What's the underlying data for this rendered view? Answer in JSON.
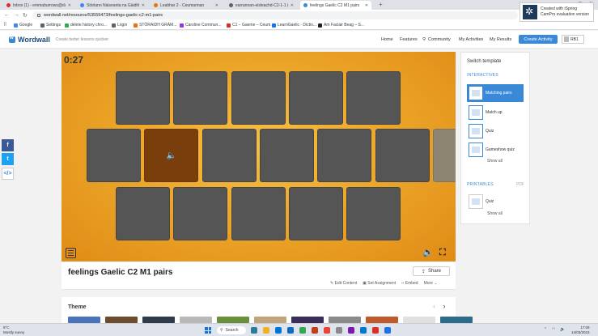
{
  "browser": {
    "tabs": [
      {
        "title": "Inbox (1) - emmaburrows@dunn...",
        "color": "#d93025",
        "active": false
      },
      {
        "title": "Stòrlann Nàiseanta na Gàidhlig...",
        "color": "#4285f4",
        "active": false
      },
      {
        "title": "Leabhar 2 - Ceumannan",
        "color": "#e8710a",
        "active": false
      },
      {
        "title": "earrannan-eisleachd-C2-1-1 (1)...",
        "color": "#5f6368",
        "active": false
      },
      {
        "title": "feelings Gaelic C2 M1 pairs",
        "color": "#3a89d8",
        "active": true
      }
    ],
    "url": "wordwall.net/resource/53559473/feelings-gaelic-c2-m1-pairs",
    "bookmarks": [
      {
        "label": "Google",
        "color": "#4285f4"
      },
      {
        "label": "Settings",
        "color": "#5f6368"
      },
      {
        "label": "delete history chro...",
        "color": "#34a853"
      },
      {
        "label": "Login",
        "color": "#5f6368"
      },
      {
        "label": "STÒRAIDH GRÀM...",
        "color": "#e8710a"
      },
      {
        "label": "Caroline Commun...",
        "color": "#9334e6"
      },
      {
        "label": "C1 – Gaeme – Ceum...",
        "color": "#d93025"
      },
      {
        "label": "LearnGaelic - Dictio...",
        "color": "#1a73e8"
      },
      {
        "label": "Am Faclair Beag – S...",
        "color": "#202124"
      }
    ]
  },
  "ispring": {
    "line1": "Created with iSpring",
    "line2": "CamPro evaluation version"
  },
  "header": {
    "logo_text": "Wordwall",
    "tagline": "Create better lessons quicker",
    "nav": [
      "Home",
      "Features",
      "Community",
      "My Activities",
      "My Results"
    ],
    "create_label": "Create Activity",
    "user_label": "RB1"
  },
  "game": {
    "timer": "0:27",
    "cards": [
      {
        "row": 0,
        "state": "hidden"
      },
      {
        "row": 0,
        "state": "hidden"
      },
      {
        "row": 0,
        "state": "hidden"
      },
      {
        "row": 0,
        "state": "hidden"
      },
      {
        "row": 0,
        "state": "hidden"
      },
      {
        "row": 1,
        "state": "hidden"
      },
      {
        "row": 1,
        "state": "audio"
      },
      {
        "row": 1,
        "state": "hidden"
      },
      {
        "row": 1,
        "state": "hidden"
      },
      {
        "row": 1,
        "state": "hidden"
      },
      {
        "row": 1,
        "state": "hidden"
      },
      {
        "row": 1,
        "state": "hover"
      },
      {
        "row": 2,
        "state": "hidden"
      },
      {
        "row": 2,
        "state": "hidden"
      },
      {
        "row": 2,
        "state": "hidden"
      },
      {
        "row": 2,
        "state": "hidden"
      },
      {
        "row": 2,
        "state": "hidden"
      }
    ]
  },
  "activity": {
    "title": "feelings Gaelic C2 M1 pairs",
    "share_label": "Share",
    "links": [
      "Edit Content",
      "Set Assignment",
      "Embed",
      "More"
    ]
  },
  "theme": {
    "label": "Theme",
    "thumb_colors": [
      "#4a74b8",
      "#6b4d2d",
      "#2d3b4a",
      "#b8b8b8",
      "#6c8f3b",
      "#c0a47a",
      "#3b2d5a",
      "#8a8a8a",
      "#c05a2d",
      "#e0e0e0",
      "#2d6b8a"
    ]
  },
  "sidebar": {
    "title": "Switch template",
    "interactives_label": "INTERACTIVES",
    "interactives": [
      {
        "label": "Matching pairs",
        "active": true
      },
      {
        "label": "Match up",
        "active": false
      },
      {
        "label": "Quiz",
        "active": false
      },
      {
        "label": "Gameshow quiz",
        "active": false
      }
    ],
    "show_all": "Show all",
    "printables_label": "PRINTABLES",
    "pdf_label": "PDF",
    "printables": [
      {
        "label": "Quiz"
      }
    ],
    "show_all_2": "Show all"
  },
  "social": [
    {
      "name": "facebook",
      "glyph": "f",
      "color": "#3b5998"
    },
    {
      "name": "twitter",
      "glyph": "t",
      "color": "#1da1f2"
    },
    {
      "name": "embed",
      "glyph": "</>",
      "color": "#ffffff"
    }
  ],
  "taskbar": {
    "weather_temp": "9°C",
    "weather_desc": "Mostly sunny",
    "search_label": "Search",
    "time": "17:09",
    "date": "14/03/2023",
    "app_colors": [
      "#2d7d9a",
      "#f2b01e",
      "#0078d4",
      "#0f6cbd",
      "#34a853",
      "#c43e1c",
      "#ea4335",
      "#8a8a8a",
      "#7719aa",
      "#0078d4",
      "#d93025",
      "#1a73e8"
    ]
  }
}
